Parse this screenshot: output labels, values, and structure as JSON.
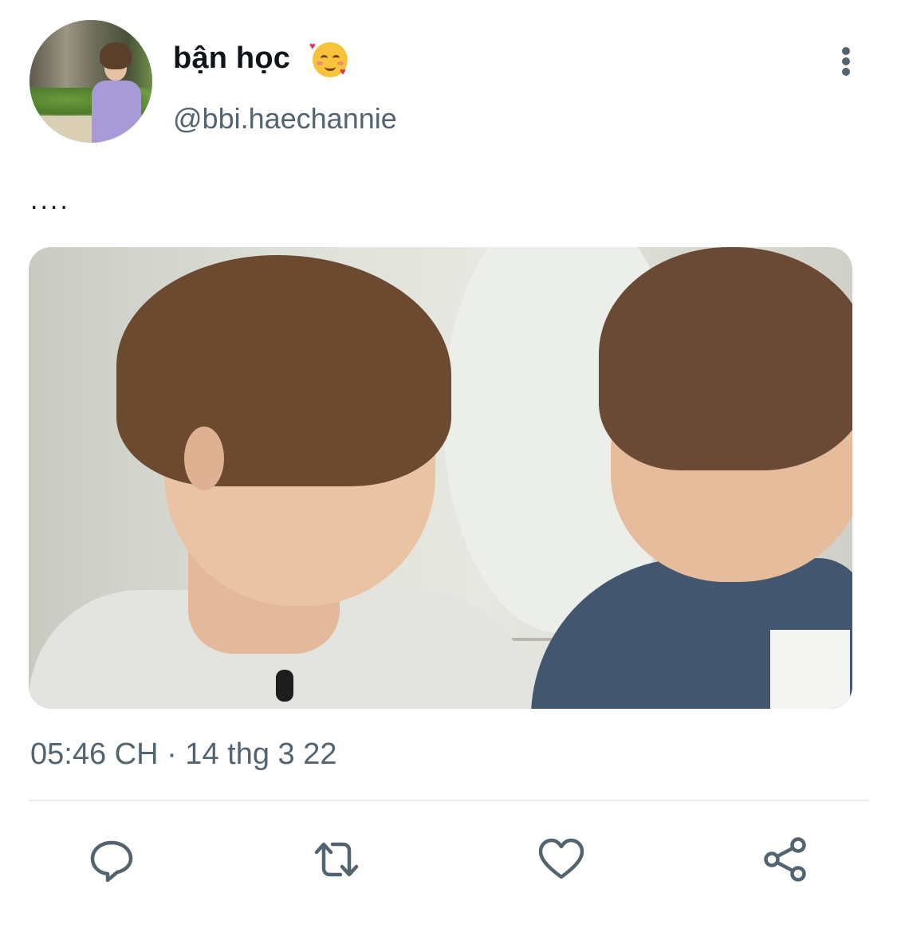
{
  "user": {
    "display_name": "bận học",
    "name_emoji": "smiling-face-with-hearts",
    "handle": "@bbi.haechannie",
    "avatar": "profile-photo"
  },
  "tweet": {
    "text": "....",
    "media": "photo-two-people-looking-at-each-other",
    "timestamp": "05:46 CH · 14 thg 3 22"
  },
  "icons": {
    "more": "more-vertical-icon",
    "reply": "reply-icon",
    "retweet": "retweet-icon",
    "like": "heart-icon",
    "share": "share-icon"
  },
  "colors": {
    "text_primary": "#0f1419",
    "text_secondary": "#536471",
    "divider": "#e8ebed"
  }
}
